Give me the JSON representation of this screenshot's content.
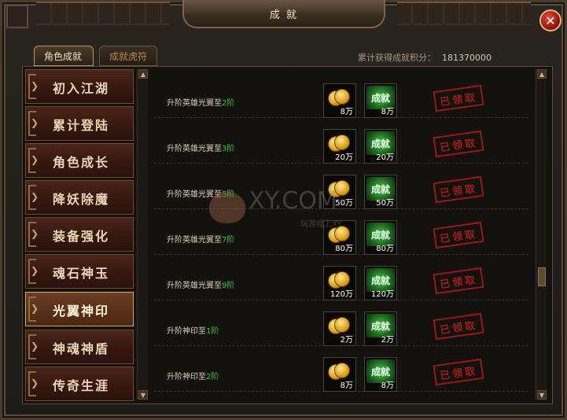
{
  "window": {
    "title": "成 就"
  },
  "tabs": [
    {
      "label": "角色成就"
    },
    {
      "label": "成就虎符"
    }
  ],
  "score": {
    "label": "累计获得成就积分：",
    "value": "181370000"
  },
  "sidebar": {
    "items": [
      {
        "label": "初入江湖"
      },
      {
        "label": "累计登陆"
      },
      {
        "label": "角色成长"
      },
      {
        "label": "降妖除魔"
      },
      {
        "label": "装备强化"
      },
      {
        "label": "魂石神玉"
      },
      {
        "label": "光翼神印"
      },
      {
        "label": "神魂神盾"
      },
      {
        "label": "传奇生涯"
      }
    ],
    "active_index": 6
  },
  "achievements": [
    {
      "title": "升阶英雄光翼至",
      "level": "2阶",
      "coin": "8万",
      "points": "8万",
      "points_label": "成就",
      "status": "已领取"
    },
    {
      "title": "升阶英雄光翼至",
      "level": "3阶",
      "coin": "20万",
      "points": "20万",
      "points_label": "成就",
      "status": "已领取"
    },
    {
      "title": "升阶英雄光翼至",
      "level": "5阶",
      "coin": "50万",
      "points": "50万",
      "points_label": "成就",
      "status": "已领取"
    },
    {
      "title": "升阶英雄光翼至",
      "level": "7阶",
      "coin": "80万",
      "points": "80万",
      "points_label": "成就",
      "status": "已领取"
    },
    {
      "title": "升阶英雄光翼至",
      "level": "9阶",
      "coin": "120万",
      "points": "120万",
      "points_label": "成就",
      "status": "已领取"
    },
    {
      "title": "升阶神印至",
      "level": "1阶",
      "coin": "2万",
      "points": "2万",
      "points_label": "成就",
      "status": "已领取"
    },
    {
      "title": "升阶神印至",
      "level": "2阶",
      "coin": "8万",
      "points": "8万",
      "points_label": "成就",
      "status": "已领取"
    }
  ],
  "watermark": {
    "text": "XY.COM",
    "sub": "玩游戏上XY"
  },
  "colors": {
    "level_green": "#38c238",
    "stamp_red": "#b01c16",
    "title_gold": "#f3e2bd"
  }
}
